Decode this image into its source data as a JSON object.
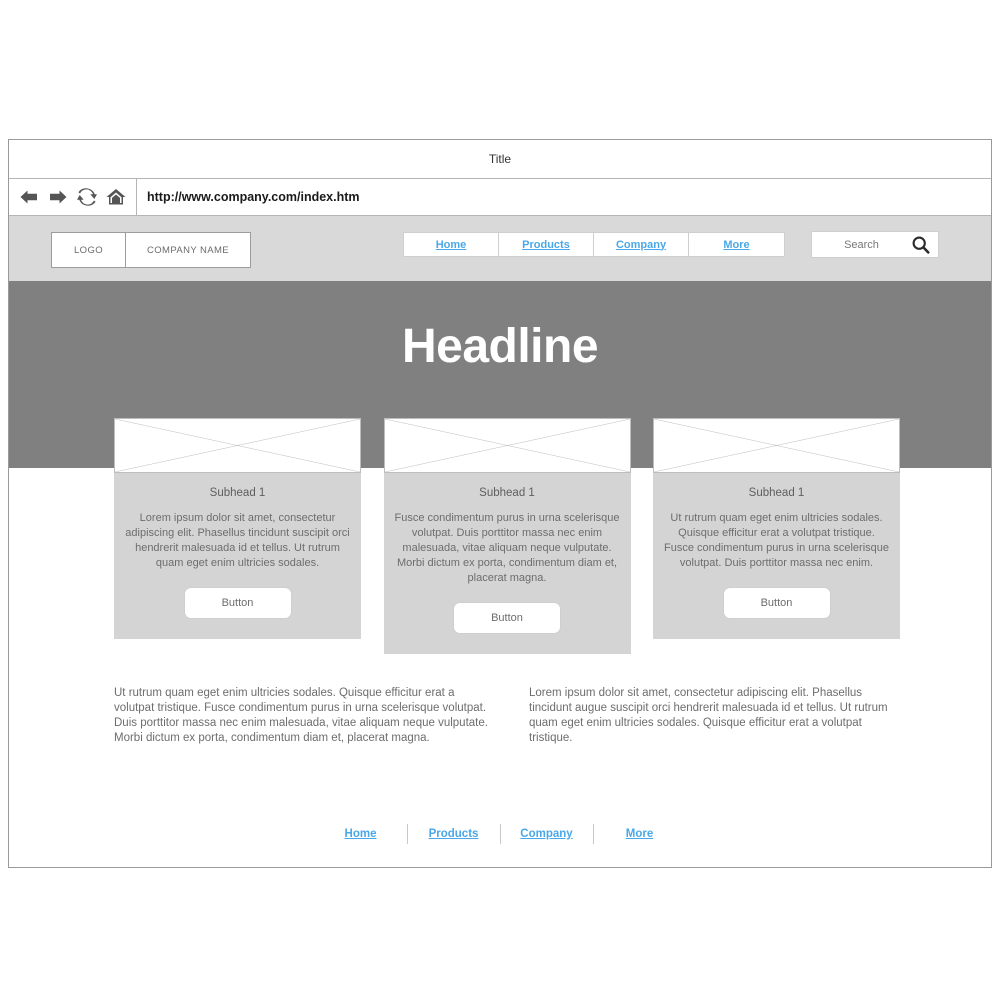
{
  "browser": {
    "title": "Title",
    "url": "http://www.company.com/index.htm",
    "toolbar_icons": [
      {
        "name": "back-icon",
        "label": "Back"
      },
      {
        "name": "forward-icon",
        "label": "Forward"
      },
      {
        "name": "refresh-icon",
        "label": "Refresh"
      },
      {
        "name": "home-icon",
        "label": "Home"
      }
    ]
  },
  "header": {
    "logo_label": "LOGO",
    "company_name": "COMPANY NAME",
    "nav": [
      {
        "label": "Home"
      },
      {
        "label": "Products"
      },
      {
        "label": "Company"
      },
      {
        "label": "More"
      }
    ],
    "search": {
      "placeholder": "Search",
      "icon": "search-icon"
    }
  },
  "hero": {
    "headline": "Headline",
    "background_color": "#808080"
  },
  "cards": [
    {
      "image_placeholder": "image-placeholder",
      "subhead": "Subhead 1",
      "text": "Lorem ipsum dolor sit amet, consectetur adipiscing elit. Phasellus tincidunt suscipit orci hendrerit malesuada id et tellus. Ut rutrum quam eget enim ultricies sodales.",
      "button_label": "Button"
    },
    {
      "image_placeholder": "image-placeholder",
      "subhead": "Subhead 1",
      "text": "Fusce condimentum purus in urna scelerisque volutpat. Duis porttitor massa nec enim malesuada, vitae aliquam neque vulputate. Morbi dictum ex porta, condimentum diam et, placerat magna.",
      "button_label": "Button"
    },
    {
      "image_placeholder": "image-placeholder",
      "subhead": "Subhead 1",
      "text": "Ut rutrum quam eget enim ultricies sodales. Quisque efficitur erat a volutpat tristique. Fusce condimentum purus in urna scelerisque volutpat. Duis porttitor massa nec enim.",
      "button_label": "Button"
    }
  ],
  "copy": {
    "left": "Ut rutrum quam eget enim ultricies sodales. Quisque efficitur erat a volutpat tristique. Fusce condimentum purus in urna scelerisque volutpat. Duis porttitor massa nec enim malesuada, vitae aliquam neque vulputate. Morbi dictum ex porta, condimentum diam et, placerat magna.",
    "right": "Lorem ipsum dolor sit amet, consectetur adipiscing elit. Phasellus tincidunt augue suscipit orci hendrerit malesuada id et tellus. Ut rutrum quam eget enim ultricies sodales. Quisque efficitur erat a volutpat tristique."
  },
  "footer": {
    "nav": [
      {
        "label": "Home"
      },
      {
        "label": "Products"
      },
      {
        "label": "Company"
      },
      {
        "label": "More"
      }
    ]
  },
  "colors": {
    "link": "#4aa8e8",
    "hero": "#808080",
    "card_body": "#d4d4d4",
    "header_bar": "#d9d9d9"
  }
}
